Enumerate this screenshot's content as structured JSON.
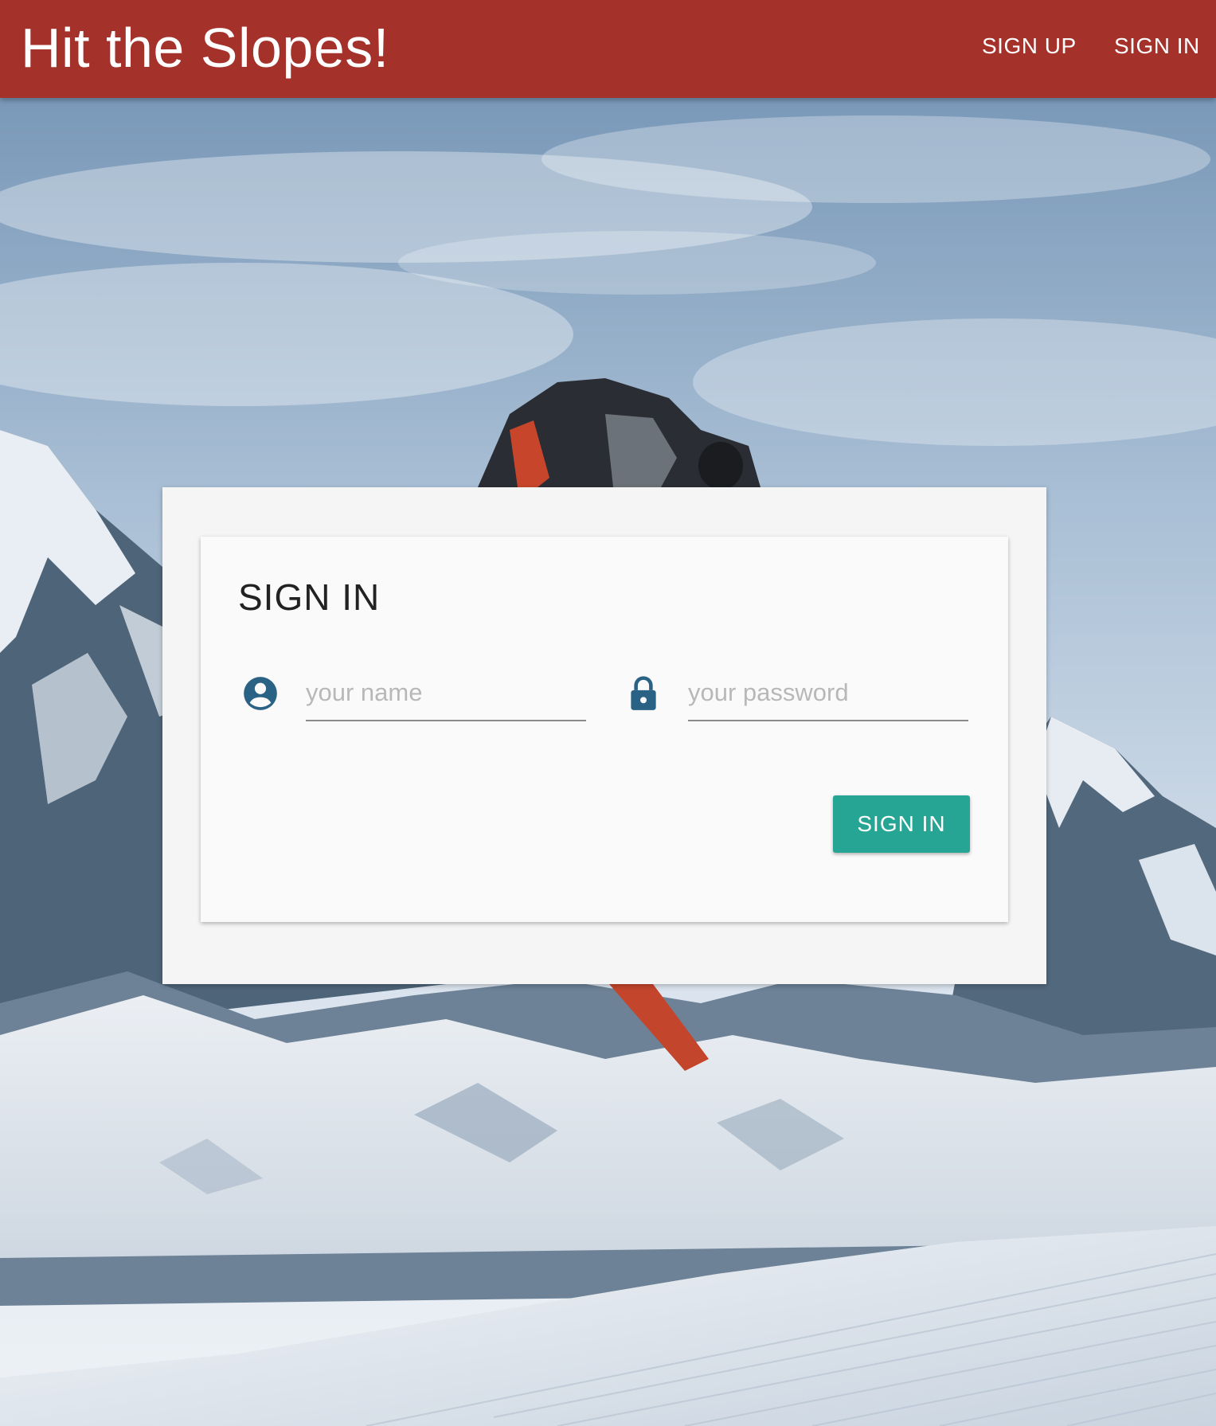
{
  "header": {
    "title": "Hit the Slopes!",
    "nav": [
      {
        "label": "SIGN UP"
      },
      {
        "label": "SIGN IN"
      }
    ]
  },
  "form": {
    "title": "SIGN IN",
    "username_placeholder": "your name",
    "password_placeholder": "your password",
    "submit_label": "SIGN IN",
    "user_icon": "account-circle-icon",
    "lock_icon": "lock-icon"
  },
  "colors": {
    "header": "#a4322b",
    "accent": "#26a594",
    "icon": "#2a6285"
  }
}
